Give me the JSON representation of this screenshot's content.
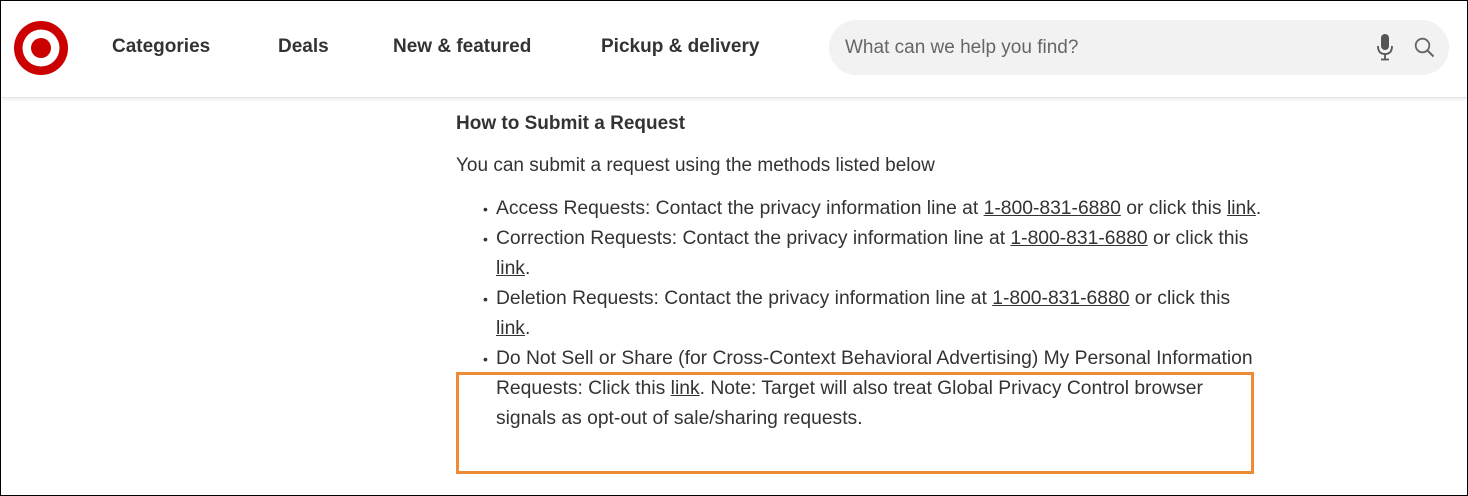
{
  "header": {
    "logo_name": "target-bullseye-logo",
    "nav": [
      {
        "label": "Categories"
      },
      {
        "label": "Deals"
      },
      {
        "label": "New & featured"
      },
      {
        "label": "Pickup & delivery"
      }
    ],
    "search": {
      "placeholder": "What can we help you find?"
    }
  },
  "content": {
    "heading": "How to Submit a Request",
    "intro": "You can submit a request using the methods listed below",
    "requests": [
      {
        "prefix": "Access Requests: Contact the privacy information line at ",
        "phone": "1-800-831-6880",
        "middle": " or click this ",
        "link": "link",
        "suffix": "."
      },
      {
        "prefix": "Correction Requests: Contact the privacy information line at ",
        "phone": "1-800-831-6880",
        "middle": " or click this ",
        "link": "link",
        "suffix": "."
      },
      {
        "prefix": "Deletion Requests: Contact the privacy information line at ",
        "phone": "1-800-831-6880",
        "middle": " or click this ",
        "link": "link",
        "suffix": "."
      },
      {
        "prefix": "Do Not Sell or Share (for Cross-Context Behavioral Advertising) My Personal Information Requests: Click this ",
        "link": "link",
        "suffix": ". Note: Target will also treat Global Privacy Control browser signals as opt-out of sale/sharing requests."
      }
    ]
  },
  "colors": {
    "brand_red": "#cc0000",
    "highlight_orange": "#ed8b36",
    "text": "#333333",
    "search_bg": "#f2f2f2"
  },
  "icons": {
    "mic": "microphone-icon",
    "search": "search-icon"
  }
}
